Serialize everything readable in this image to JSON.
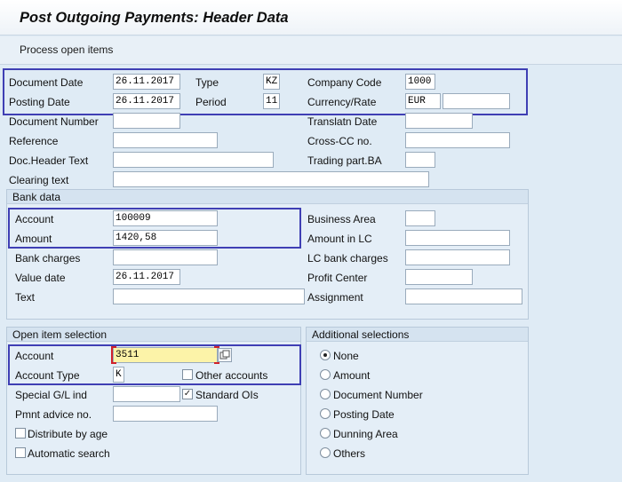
{
  "header": {
    "title": "Post Outgoing Payments: Header Data"
  },
  "toolbar": {
    "process_open_items": "Process open items"
  },
  "doc": {
    "document_date_label": "Document Date",
    "document_date": "26.11.2017",
    "type_label": "Type",
    "type": "KZ",
    "company_code_label": "Company Code",
    "company_code": "1000",
    "posting_date_label": "Posting Date",
    "posting_date": "26.11.2017",
    "period_label": "Period",
    "period": "11",
    "currency_label": "Currency/Rate",
    "currency": "EUR",
    "rate": "",
    "document_number_label": "Document Number",
    "document_number": "",
    "translatn_date_label": "Translatn Date",
    "translatn_date": "",
    "reference_label": "Reference",
    "reference": "",
    "cross_cc_label": "Cross-CC no.",
    "cross_cc": "",
    "doc_header_text_label": "Doc.Header Text",
    "doc_header_text": "",
    "trading_part_label": "Trading part.BA",
    "trading_part": "",
    "clearing_text_label": "Clearing text",
    "clearing_text": ""
  },
  "bank": {
    "group_title": "Bank data",
    "account_label": "Account",
    "account": "100009",
    "business_area_label": "Business Area",
    "business_area": "",
    "amount_label": "Amount",
    "amount": "1420,58",
    "amount_lc_label": "Amount in LC",
    "amount_lc": "",
    "bank_charges_label": "Bank charges",
    "bank_charges": "",
    "lc_bank_charges_label": "LC bank charges",
    "lc_bank_charges": "",
    "value_date_label": "Value date",
    "value_date": "26.11.2017",
    "profit_center_label": "Profit Center",
    "profit_center": "",
    "text_label": "Text",
    "text": "",
    "assignment_label": "Assignment",
    "assignment": ""
  },
  "open_items": {
    "group_title": "Open item selection",
    "account_label": "Account",
    "account": "3511",
    "account_type_label": "Account Type",
    "account_type": "K",
    "other_accounts_label": "Other accounts",
    "other_accounts_checked": false,
    "special_gl_label": "Special G/L ind",
    "special_gl": "",
    "standard_ois_label": "Standard OIs",
    "standard_ois_checked": true,
    "pmnt_advice_label": "Pmnt advice no.",
    "pmnt_advice": "",
    "distribute_by_age_label": "Distribute by age",
    "automatic_search_label": "Automatic search"
  },
  "additional": {
    "group_title": "Additional selections",
    "options": [
      "None",
      "Amount",
      "Document Number",
      "Posting Date",
      "Dunning Area",
      "Others"
    ],
    "selected": "None"
  },
  "icons": {
    "checkmark": "✓",
    "search_help": "value-help-icon"
  },
  "colors": {
    "highlight_border": "#3f3fb4",
    "active_field": "#fcf3a8",
    "required_mark": "#d0202a"
  }
}
